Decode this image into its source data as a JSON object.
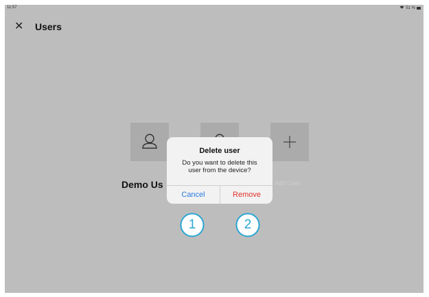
{
  "status_bar": {
    "time": "11:57",
    "battery": "51 %"
  },
  "nav": {
    "title": "Users",
    "close_icon": "close-icon"
  },
  "users": [
    {
      "label": "Demo Us",
      "icon": "person-icon"
    },
    {
      "label": "",
      "icon": "person-icon"
    },
    {
      "label": "Add User",
      "icon": "plus-icon"
    }
  ],
  "alert": {
    "title": "Delete user",
    "message": "Do you want to delete this user from the device?",
    "cancel_label": "Cancel",
    "remove_label": "Remove"
  },
  "callouts": [
    "1",
    "2"
  ],
  "colors": {
    "overlay": "#bdbdbd",
    "cancel": "#2a7be0",
    "remove": "#e0302a",
    "callout": "#2aa6d4"
  }
}
